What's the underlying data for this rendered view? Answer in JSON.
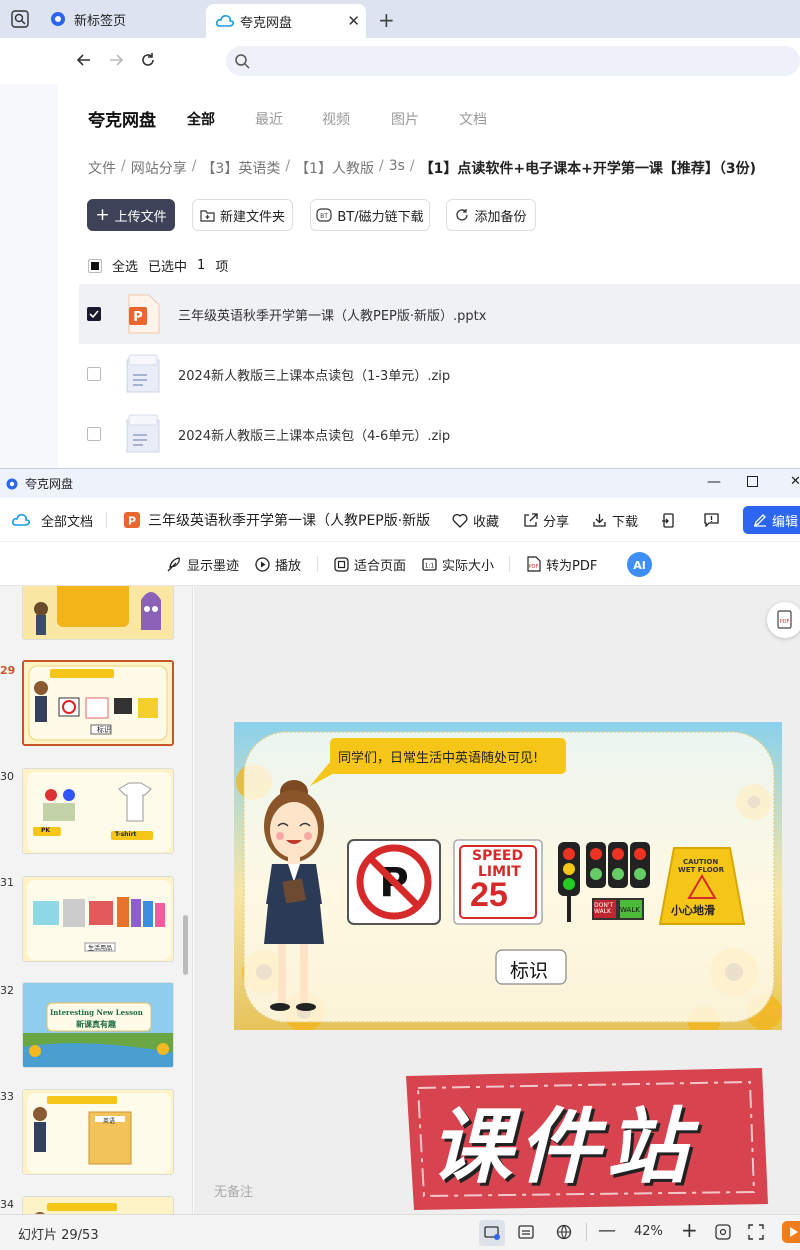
{
  "browser": {
    "tab1_label": "新标签页",
    "tab2_label": "夸克网盘",
    "url_value": ""
  },
  "page": {
    "logo": "夸克网盘",
    "nav_tabs": [
      "全部",
      "最近",
      "视频",
      "图片",
      "文档"
    ],
    "breadcrumb": [
      "文件",
      "网站分享",
      "【3】英语类",
      "【1】人教版",
      "3s",
      "【1】点读软件+电子课本+开学第一课【推荐】（3份)"
    ],
    "buttons": {
      "upload": "上传文件",
      "new_folder": "新建文件夹",
      "bt": "BT/磁力链下载",
      "backup": "添加备份"
    },
    "select_all": "全选",
    "selected_prefix": "已选中",
    "selected_count": "1",
    "selected_unit": "项",
    "files": [
      {
        "name": "三年级英语秋季开学第一课（人教PEP版·新版）.pptx",
        "type": "pptx",
        "selected": true
      },
      {
        "name": "2024新人教版三上课本点读包（1-3单元）.zip",
        "type": "zip",
        "selected": false
      },
      {
        "name": "2024新人教版三上课本点读包（4-6单元）.zip",
        "type": "zip",
        "selected": false
      }
    ]
  },
  "app": {
    "window_title": "夸克网盘",
    "all_docs": "全部文档",
    "doc_title": "三年级英语秋季开学第一课（人教PEP版·新版",
    "favorite": "收藏",
    "share": "分享",
    "download": "下载",
    "edit": "编辑",
    "view_toolbar": {
      "show_ink": "显示墨迹",
      "play": "播放",
      "fit_page": "适合页面",
      "actual_size": "实际大小",
      "to_pdf": "转为PDF"
    },
    "thumbnails": [
      "29",
      "30",
      "31",
      "32",
      "33",
      "34"
    ],
    "thumb_labels": {
      "t29": "标识",
      "t30a": "PK",
      "t30b": "T-shirt",
      "t31": "生活用品",
      "t32a": "Interesting New Lesson",
      "t32b": "新课真有趣",
      "t33": "英语"
    },
    "slide": {
      "speech": "同学们，日常生活中英语随处可见!",
      "speed_top": "SPEED",
      "speed_mid": "LIMIT",
      "speed_num": "25",
      "dont_walk": "DON'T WALK",
      "walk": "WALK",
      "caution": "CAUTION",
      "wet_floor": "WET FLOOR",
      "caution_cn": "小心地滑",
      "caption": "标识"
    },
    "watermark": "课件站",
    "notes_placeholder": "无备注",
    "status": {
      "slide_counter": "幻灯片 29/53",
      "zoom": "42%"
    }
  },
  "colors": {
    "accent": "#2b65f0",
    "upload_bg": "#3d4258",
    "thumb_selected": "#c8562d",
    "watermark": "#d7434f"
  }
}
